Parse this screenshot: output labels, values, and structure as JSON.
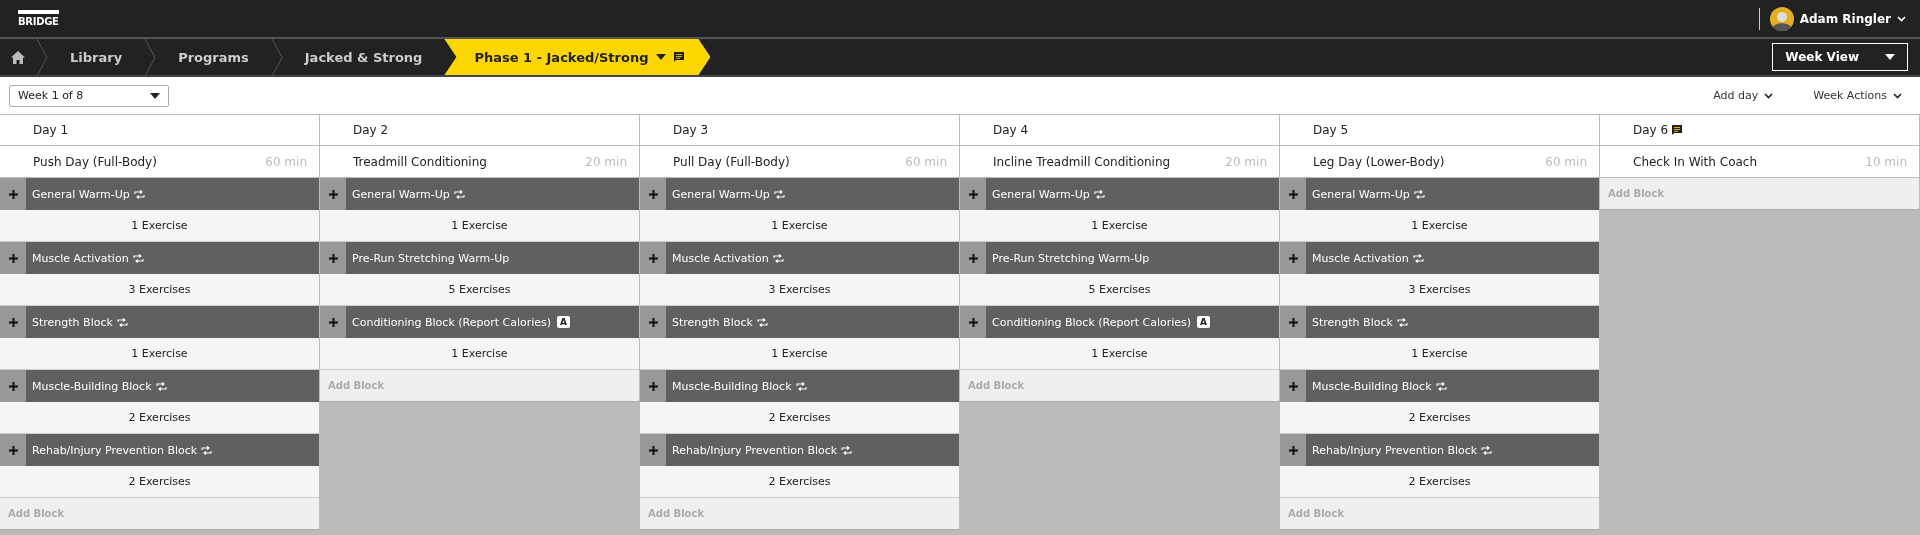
{
  "brand": {
    "logo": "BRIDGE"
  },
  "user": {
    "name": "Adam Ringler"
  },
  "breadcrumbs": [
    {
      "label": "Library",
      "selected": false
    },
    {
      "label": "Programs",
      "selected": false
    },
    {
      "label": "Jacked & Strong",
      "selected": false
    },
    {
      "label": "Phase 1 - Jacked/Strong",
      "selected": true
    }
  ],
  "view_select": {
    "value": "Week View"
  },
  "week_select": {
    "value": "Week 1 of 8"
  },
  "actions": [
    "Add day",
    "Week Actions"
  ],
  "days": [
    {
      "label": "Day 1",
      "has_note": false,
      "workout": "Push Day (Full-Body)",
      "duration": "60 min",
      "add_label": "Add Block",
      "blocks": [
        {
          "title": "General Warm-Up",
          "kind": "repeat",
          "count": "1 Exercise"
        },
        {
          "title": "Muscle Activation",
          "kind": "repeat",
          "count": "3 Exercises"
        },
        {
          "title": "Strength Block",
          "kind": "repeat",
          "count": "1 Exercise"
        },
        {
          "title": "Muscle-Building Block",
          "kind": "repeat",
          "count": "2 Exercises"
        },
        {
          "title": "Rehab/Injury Prevention Block",
          "kind": "repeat",
          "count": "2 Exercises"
        }
      ]
    },
    {
      "label": "Day 2",
      "has_note": false,
      "workout": "Treadmill Conditioning",
      "duration": "20 min",
      "add_label": "Add Block",
      "blocks": [
        {
          "title": "General Warm-Up",
          "kind": "repeat",
          "count": "1 Exercise"
        },
        {
          "title": "Pre-Run Stretching Warm-Up",
          "kind": "plain",
          "count": "5 Exercises"
        },
        {
          "title": "Conditioning Block (Report Calories)",
          "kind": "badge",
          "badge": "A",
          "count": "1 Exercise"
        }
      ]
    },
    {
      "label": "Day 3",
      "has_note": false,
      "workout": "Pull Day (Full-Body)",
      "duration": "60 min",
      "add_label": "Add Block",
      "blocks": [
        {
          "title": "General Warm-Up",
          "kind": "repeat",
          "count": "1 Exercise"
        },
        {
          "title": "Muscle Activation",
          "kind": "repeat",
          "count": "3 Exercises"
        },
        {
          "title": "Strength Block",
          "kind": "repeat",
          "count": "1 Exercise"
        },
        {
          "title": "Muscle-Building Block",
          "kind": "repeat",
          "count": "2 Exercises"
        },
        {
          "title": "Rehab/Injury Prevention Block",
          "kind": "repeat",
          "count": "2 Exercises"
        }
      ]
    },
    {
      "label": "Day 4",
      "has_note": false,
      "workout": "Incline Treadmill Conditioning",
      "duration": "20 min",
      "add_label": "Add Block",
      "blocks": [
        {
          "title": "General Warm-Up",
          "kind": "repeat",
          "count": "1 Exercise"
        },
        {
          "title": "Pre-Run Stretching Warm-Up",
          "kind": "plain",
          "count": "5 Exercises"
        },
        {
          "title": "Conditioning Block (Report Calories)",
          "kind": "badge",
          "badge": "A",
          "count": "1 Exercise"
        }
      ]
    },
    {
      "label": "Day 5",
      "has_note": false,
      "workout": "Leg Day (Lower-Body)",
      "duration": "60 min",
      "add_label": "Add Block",
      "blocks": [
        {
          "title": "General Warm-Up",
          "kind": "repeat",
          "count": "1 Exercise"
        },
        {
          "title": "Muscle Activation",
          "kind": "repeat",
          "count": "3 Exercises"
        },
        {
          "title": "Strength Block",
          "kind": "repeat",
          "count": "1 Exercise"
        },
        {
          "title": "Muscle-Building Block",
          "kind": "repeat",
          "count": "2 Exercises"
        },
        {
          "title": "Rehab/Injury Prevention Block",
          "kind": "repeat",
          "count": "2 Exercises"
        }
      ]
    },
    {
      "label": "Day 6",
      "has_note": true,
      "workout": "Check In With Coach",
      "duration": "10 min",
      "add_label": "Add Block"
    }
  ]
}
